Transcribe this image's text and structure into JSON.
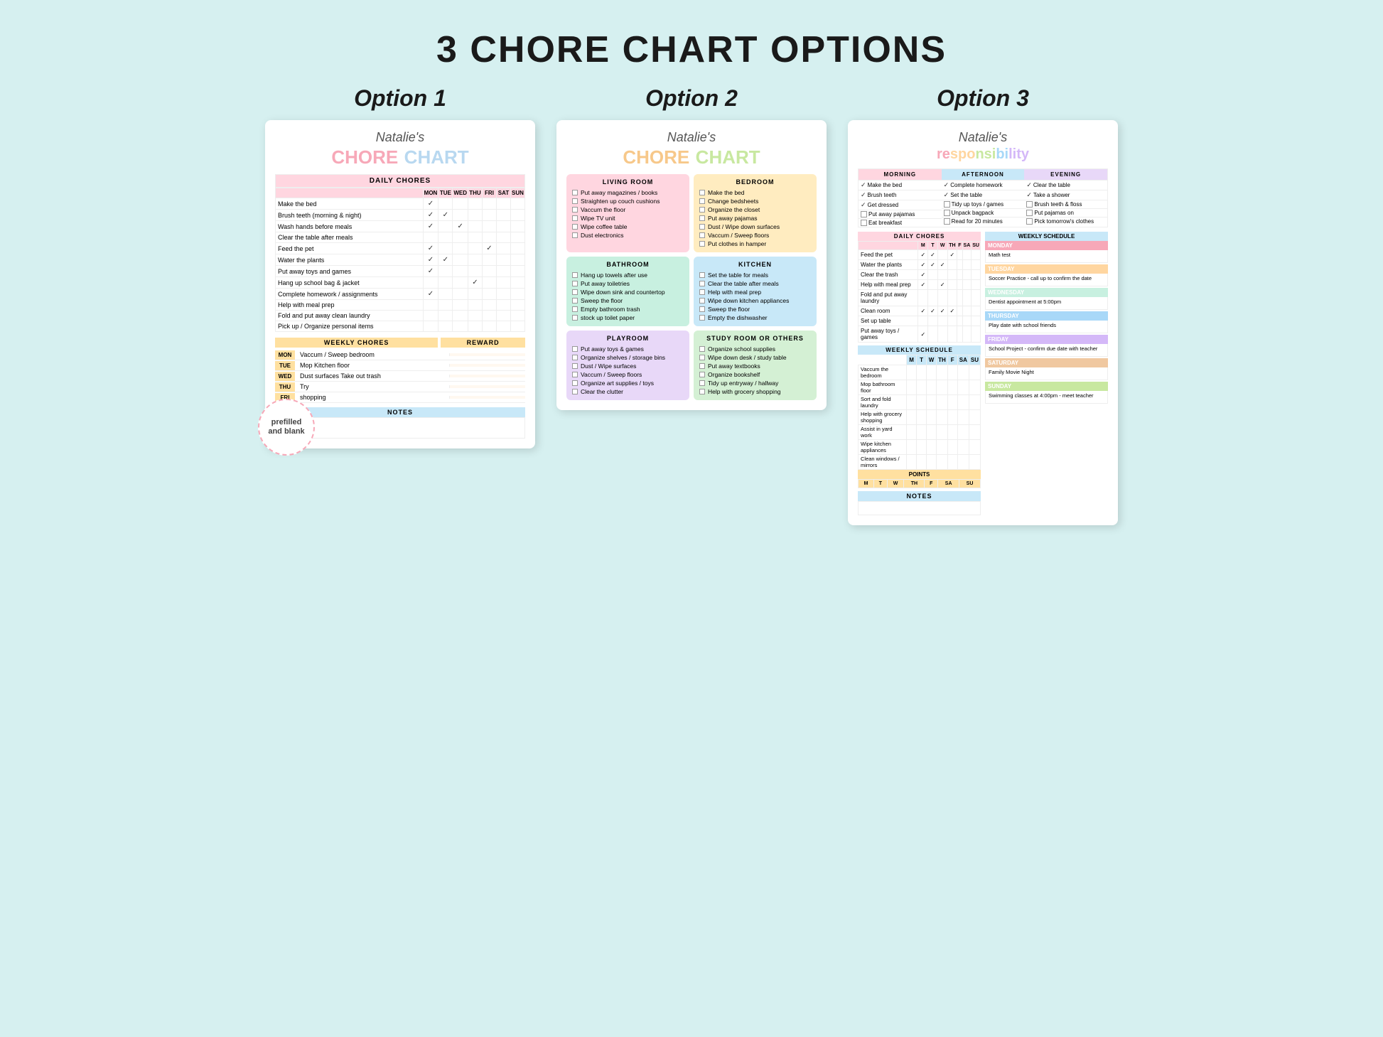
{
  "page": {
    "title": "3 CHORE CHART OPTIONS",
    "bg_color": "#d6f0f0"
  },
  "options": [
    {
      "label": "Option 1",
      "name_script": "Natalie's",
      "chart_title_words": [
        "CHORE",
        "CHART"
      ],
      "section_daily": "DAILY CHORES",
      "days": [
        "MON",
        "TUE",
        "WED",
        "THU",
        "FRI",
        "SAT",
        "SUN"
      ],
      "daily_chores": [
        {
          "name": "Make the bed",
          "checks": [
            true,
            false,
            false,
            false,
            false,
            false,
            false
          ]
        },
        {
          "name": "Brush teeth (morning & night)",
          "checks": [
            true,
            true,
            false,
            false,
            false,
            false,
            false
          ]
        },
        {
          "name": "Wash hands before meals",
          "checks": [
            true,
            false,
            true,
            false,
            false,
            false,
            false
          ]
        },
        {
          "name": "Clear the table after meals",
          "checks": [
            false,
            false,
            false,
            false,
            false,
            false,
            false
          ]
        },
        {
          "name": "Feed the pet",
          "checks": [
            true,
            false,
            false,
            false,
            true,
            false,
            false
          ]
        },
        {
          "name": "Water the plants",
          "checks": [
            true,
            true,
            false,
            false,
            false,
            false,
            false
          ]
        },
        {
          "name": "Put away toys and games",
          "checks": [
            true,
            false,
            false,
            false,
            false,
            false,
            false
          ]
        },
        {
          "name": "Hang up school bag & jacket",
          "checks": [
            false,
            false,
            false,
            true,
            false,
            false,
            false
          ]
        },
        {
          "name": "Complete homework / assignments",
          "checks": [
            true,
            false,
            false,
            false,
            false,
            false,
            false
          ]
        },
        {
          "name": "Help with meal prep",
          "checks": [
            false,
            false,
            false,
            false,
            false,
            false,
            false
          ]
        },
        {
          "name": "Fold and put away clean laundry",
          "checks": [
            false,
            false,
            false,
            false,
            false,
            false,
            false
          ]
        },
        {
          "name": "Pick up / Organize personal items",
          "checks": [
            false,
            false,
            false,
            false,
            false,
            false,
            false
          ]
        }
      ],
      "section_weekly": "WEEKLY CHORES",
      "section_reward": "REWARD",
      "weekly_chores": [
        {
          "day": "MON",
          "task": "Vaccum / Sweep bedroom",
          "reward": ""
        },
        {
          "day": "TUE",
          "task": "Mop Kitchen floor",
          "reward": ""
        },
        {
          "day": "WED",
          "task": "Dust surfaces Take out trash",
          "reward": ""
        },
        {
          "day": "THU",
          "task": "Try",
          "reward": ""
        },
        {
          "day": "FRI",
          "task": "shopping",
          "reward": ""
        }
      ],
      "section_notes": "NOTES",
      "badge_text": "prefilled and blank"
    },
    {
      "label": "Option 2",
      "name_script": "Natalie's",
      "chart_title_words": [
        "CHORE",
        "CHART"
      ],
      "rooms": [
        {
          "title": "LIVING ROOM",
          "color": "r-living",
          "items": [
            "Put away magazines / books",
            "Straighten up couch cushions",
            "Vaccum the floor",
            "Wipe TV unit",
            "Wipe coffee table",
            "Dust electronics"
          ]
        },
        {
          "title": "BEDROOM",
          "color": "r-bedroom",
          "items": [
            "Make the bed",
            "Change bedsheets",
            "Organize the closet",
            "Put away pajamas",
            "Dust / Wipe down surfaces",
            "Vaccum / Sweep floors",
            "Put clothes in hamper"
          ]
        },
        {
          "title": "BATHROOM",
          "color": "r-bathroom",
          "items": [
            "Hang up towels after use",
            "Put away toiletries",
            "Wipe down sink and countertop",
            "Sweep the floor",
            "Empty bathroom trash",
            "stock up toilet paper"
          ]
        },
        {
          "title": "KITCHEN",
          "color": "r-kitchen",
          "items": [
            "Set the table for meals",
            "Clear the table after meals",
            "Help with meal prep",
            "Wipe down kitchen appliances",
            "Sweep the floor",
            "Empty the dishwasher"
          ]
        },
        {
          "title": "PLAYROOM",
          "color": "r-playroom",
          "items": [
            "Put away toys & games",
            "Organize shelves / storage bins",
            "Dust / Wipe surfaces",
            "Vaccum / Sweep floors",
            "Organize art supplies / toys",
            "Clear the clutter"
          ]
        },
        {
          "title": "STUDY ROOM OR OTHERS",
          "color": "r-study",
          "items": [
            "Organize school supplies",
            "Wipe down desk / study table",
            "Put away textbooks",
            "Organize bookshelf",
            "Tidy up entryway / hallway",
            "Help with grocery shopping"
          ]
        }
      ]
    },
    {
      "label": "Option 3",
      "name_script": "Natalie's",
      "chart_title": "responsibility",
      "time_of_day": {
        "morning": {
          "label": "MORNING",
          "items": [
            {
              "text": "Make the bed",
              "checked": true
            },
            {
              "text": "Brush teeth",
              "checked": true
            },
            {
              "text": "Get dressed",
              "checked": true
            },
            {
              "text": "Put away pajamas",
              "checked": false
            },
            {
              "text": "Eat breakfast",
              "checked": false
            }
          ]
        },
        "afternoon": {
          "label": "AFTERNOON",
          "items": [
            {
              "text": "Complete homework",
              "checked": true
            },
            {
              "text": "Set the table",
              "checked": true
            },
            {
              "text": "Tidy up toys / games",
              "checked": false
            },
            {
              "text": "Unpack bagpack",
              "checked": false
            },
            {
              "text": "Read for 20 minutes",
              "checked": false
            }
          ]
        },
        "evening": {
          "label": "EVENING",
          "items": [
            {
              "text": "Clear the table",
              "checked": true
            },
            {
              "text": "Take a shower",
              "checked": true
            },
            {
              "text": "Brush teeth & floss",
              "checked": false
            },
            {
              "text": "Put pajamas on",
              "checked": false
            },
            {
              "text": "Pick tomorrow's clothes",
              "checked": false
            }
          ]
        }
      },
      "daily_chores_section": {
        "label": "DAILY CHORES",
        "days": [
          "M",
          "T",
          "W",
          "TH",
          "F",
          "SA",
          "SU"
        ],
        "items": [
          {
            "name": "Feed the pet",
            "checks": [
              true,
              true,
              false,
              true,
              false,
              false,
              false
            ]
          },
          {
            "name": "Water the plants",
            "checks": [
              true,
              true,
              true,
              false,
              false,
              false,
              false
            ]
          },
          {
            "name": "Clear the trash",
            "checks": [
              true,
              false,
              false,
              false,
              false,
              false,
              false
            ]
          },
          {
            "name": "Help with meal prep",
            "checks": [
              true,
              false,
              true,
              false,
              false,
              false,
              false
            ]
          },
          {
            "name": "Fold and put away laundry",
            "checks": [
              false,
              false,
              false,
              false,
              false,
              false,
              false
            ]
          },
          {
            "name": "Clean room",
            "checks": [
              true,
              true,
              true,
              true,
              false,
              false,
              false
            ]
          },
          {
            "name": "Set up table",
            "checks": [
              false,
              false,
              false,
              false,
              false,
              false,
              false
            ]
          },
          {
            "name": "Put away toys / games",
            "checks": [
              true,
              false,
              false,
              false,
              false,
              false,
              false
            ]
          }
        ]
      },
      "weekly_schedule_section": {
        "label": "WEEKLY SCHEDULE",
        "items": [
          {
            "name": "Vaccum the bedroom"
          },
          {
            "name": "Mop bathroom floor"
          },
          {
            "name": "Sort and fold laundry"
          },
          {
            "name": "Help with grocery shopping"
          },
          {
            "name": "Assist in yard work"
          },
          {
            "name": "Wipe kitchen appliances"
          },
          {
            "name": "Clean windows / mirrors"
          }
        ],
        "days_short": [
          "M",
          "T",
          "W",
          "TH",
          "F",
          "SA",
          "SU"
        ]
      },
      "weekly_calendar": {
        "label": "WEEKLY SCHEDULE",
        "days": [
          {
            "name": "MONDAY",
            "color": "d-monday",
            "event": "Math test"
          },
          {
            "name": "TUESDAY",
            "color": "d-tuesday",
            "event": "Soccer Practice - call up to confirm the date"
          },
          {
            "name": "WEDNESDAY",
            "color": "d-wednesday",
            "event": "Dentist appointment at 5:00pm"
          },
          {
            "name": "THURSDAY",
            "color": "d-thursday",
            "event": "Play date with school friends"
          },
          {
            "name": "FRIDAY",
            "color": "d-friday",
            "event": "School Project - confirm due date with teacher"
          },
          {
            "name": "SATURDAY",
            "color": "d-saturday",
            "event": "Family Movie Night"
          },
          {
            "name": "SUNDAY",
            "color": "d-sunday",
            "event": "Swimming classes at 4:00pm - meet teacher"
          }
        ]
      },
      "points": {
        "label": "POINTS",
        "days_short": [
          "M",
          "T",
          "W",
          "TH",
          "F",
          "SA",
          "SU"
        ]
      },
      "notes_label": "NOTES"
    }
  ]
}
